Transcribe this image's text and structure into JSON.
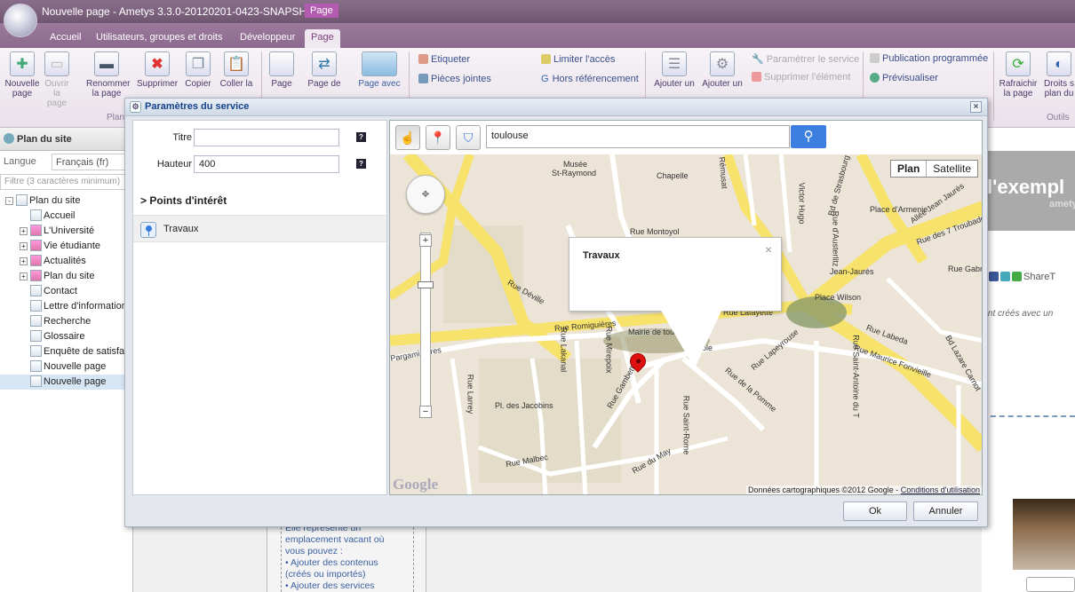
{
  "window": {
    "title": "Nouvelle page - Ametys 3.3.0-20120201-0423-SNAPSH",
    "context_tab": "Page"
  },
  "tabs": [
    {
      "label": "Accueil"
    },
    {
      "label": "Utilisateurs, groupes et droits"
    },
    {
      "label": "Développeur"
    },
    {
      "label": "Page"
    }
  ],
  "ribbon": {
    "buttons": [
      {
        "l1": "Nouvelle",
        "l2": "page"
      },
      {
        "l1": "Ouvrir",
        "l2": "la page"
      },
      {
        "l1": "Renommer",
        "l2": "la page"
      },
      {
        "l1": "Supprimer",
        "l2": ""
      },
      {
        "l1": "Copier",
        "l2": ""
      },
      {
        "l1": "Coller la",
        "l2": ""
      },
      {
        "l1": "Page",
        "l2": ""
      },
      {
        "l1": "Page de",
        "l2": ""
      },
      {
        "l1": "Page avec",
        "l2": ""
      }
    ],
    "group_plan": "Plan",
    "small": {
      "etiqueter": "Etiqueter",
      "pieces": "Pièces jointes",
      "limiter": "Limiter l'accès",
      "hors_ref": "Hors référencement",
      "ajouter1": "Ajouter un",
      "ajouter2": "Ajouter un",
      "param_service": "Paramétrer le service",
      "suppr_element": "Supprimer l'élément",
      "publication": "Publication programmée",
      "previsualiser": "Prévisualiser"
    },
    "outils": {
      "refresh_l1": "Rafraichir",
      "refresh_l2": "la page",
      "droits_l1": "Droits s",
      "droits_l2": "plan du",
      "group": "Outils"
    }
  },
  "sidebar": {
    "title": "Plan du site",
    "lang_label": "Langue",
    "lang_value": "Français (fr)",
    "filter_placeholder": "Filtre (3 caractères minimum)",
    "tree": [
      {
        "label": "Plan du site",
        "level": 0,
        "expander": "−"
      },
      {
        "label": "Accueil",
        "level": 1
      },
      {
        "label": "L'Université",
        "level": 1,
        "expander": "+"
      },
      {
        "label": "Vie étudiante",
        "level": 1,
        "expander": "+"
      },
      {
        "label": "Actualités",
        "level": 1,
        "expander": "+"
      },
      {
        "label": "Plan du site",
        "level": 1,
        "expander": "+"
      },
      {
        "label": "Contact",
        "level": 1
      },
      {
        "label": "Lettre d'information",
        "level": 1
      },
      {
        "label": "Recherche",
        "level": 1
      },
      {
        "label": "Glossaire",
        "level": 1
      },
      {
        "label": "Enquête de satisfa",
        "level": 1
      },
      {
        "label": "Nouvelle page",
        "level": 1
      },
      {
        "label": "Nouvelle page",
        "level": 1
      }
    ]
  },
  "background": {
    "banner": "l'exempl",
    "banner_sub": "amety",
    "share": "ShareT",
    "text": "ment créés avec un",
    "help": [
      "Elle représente un",
      "emplacement vacant où",
      "vous pouvez :",
      "• Ajouter des contenus",
      "(créés ou importés)",
      "• Ajouter des services"
    ]
  },
  "dialog": {
    "title": "Paramètres du service",
    "fields": {
      "titre_label": "Titre",
      "titre_value": "",
      "hauteur_label": "Hauteur",
      "hauteur_value": "400"
    },
    "poi_title": "Points d'intérêt",
    "poi_items": [
      "Travaux"
    ],
    "map": {
      "search_value": "toulouse",
      "type_plan": "Plan",
      "type_satellite": "Satellite",
      "bubble_title": "Travaux",
      "attribution": "Données cartographiques ©2012 Google - ",
      "attribution_link": "Conditions d'utilisation",
      "logo": "Google",
      "labels": [
        "Musée",
        "St-Raymond",
        "Chapelle",
        "Rue Montoyol",
        "Place d'Armenie",
        "Jean-Jaurès",
        "Rue Gabr",
        "Place Wilson",
        "Rue Romiguières",
        "Rue Lafayette",
        "Capitole",
        "Mairie de toulou",
        "Rue Labeda",
        "Rue Maurice Fonvieille",
        "Pl. des Jacobins",
        "Rue Malbec",
        "Rue de la Pomme",
        "Rue Déville",
        "Pargaminières",
        "Rue Lakanal",
        "Rue Mirepoix",
        "Rue Gambetta",
        "Rue Larrey",
        "Bd de Strasbourg",
        "Allée Jean Jaurès",
        "Bd Lazare Carnot",
        "Rue des 7 Troubadours",
        "Rue de Rémusat",
        "Victor Hugo",
        "Rue d'Austerlitz",
        "Rue Saint-Antoine du T",
        "Rue du Rempart Sa",
        "Rue Lapeyrouse",
        "Rue du May",
        "Rue Saint-Rome"
      ]
    },
    "ok": "Ok",
    "cancel": "Annuler"
  }
}
